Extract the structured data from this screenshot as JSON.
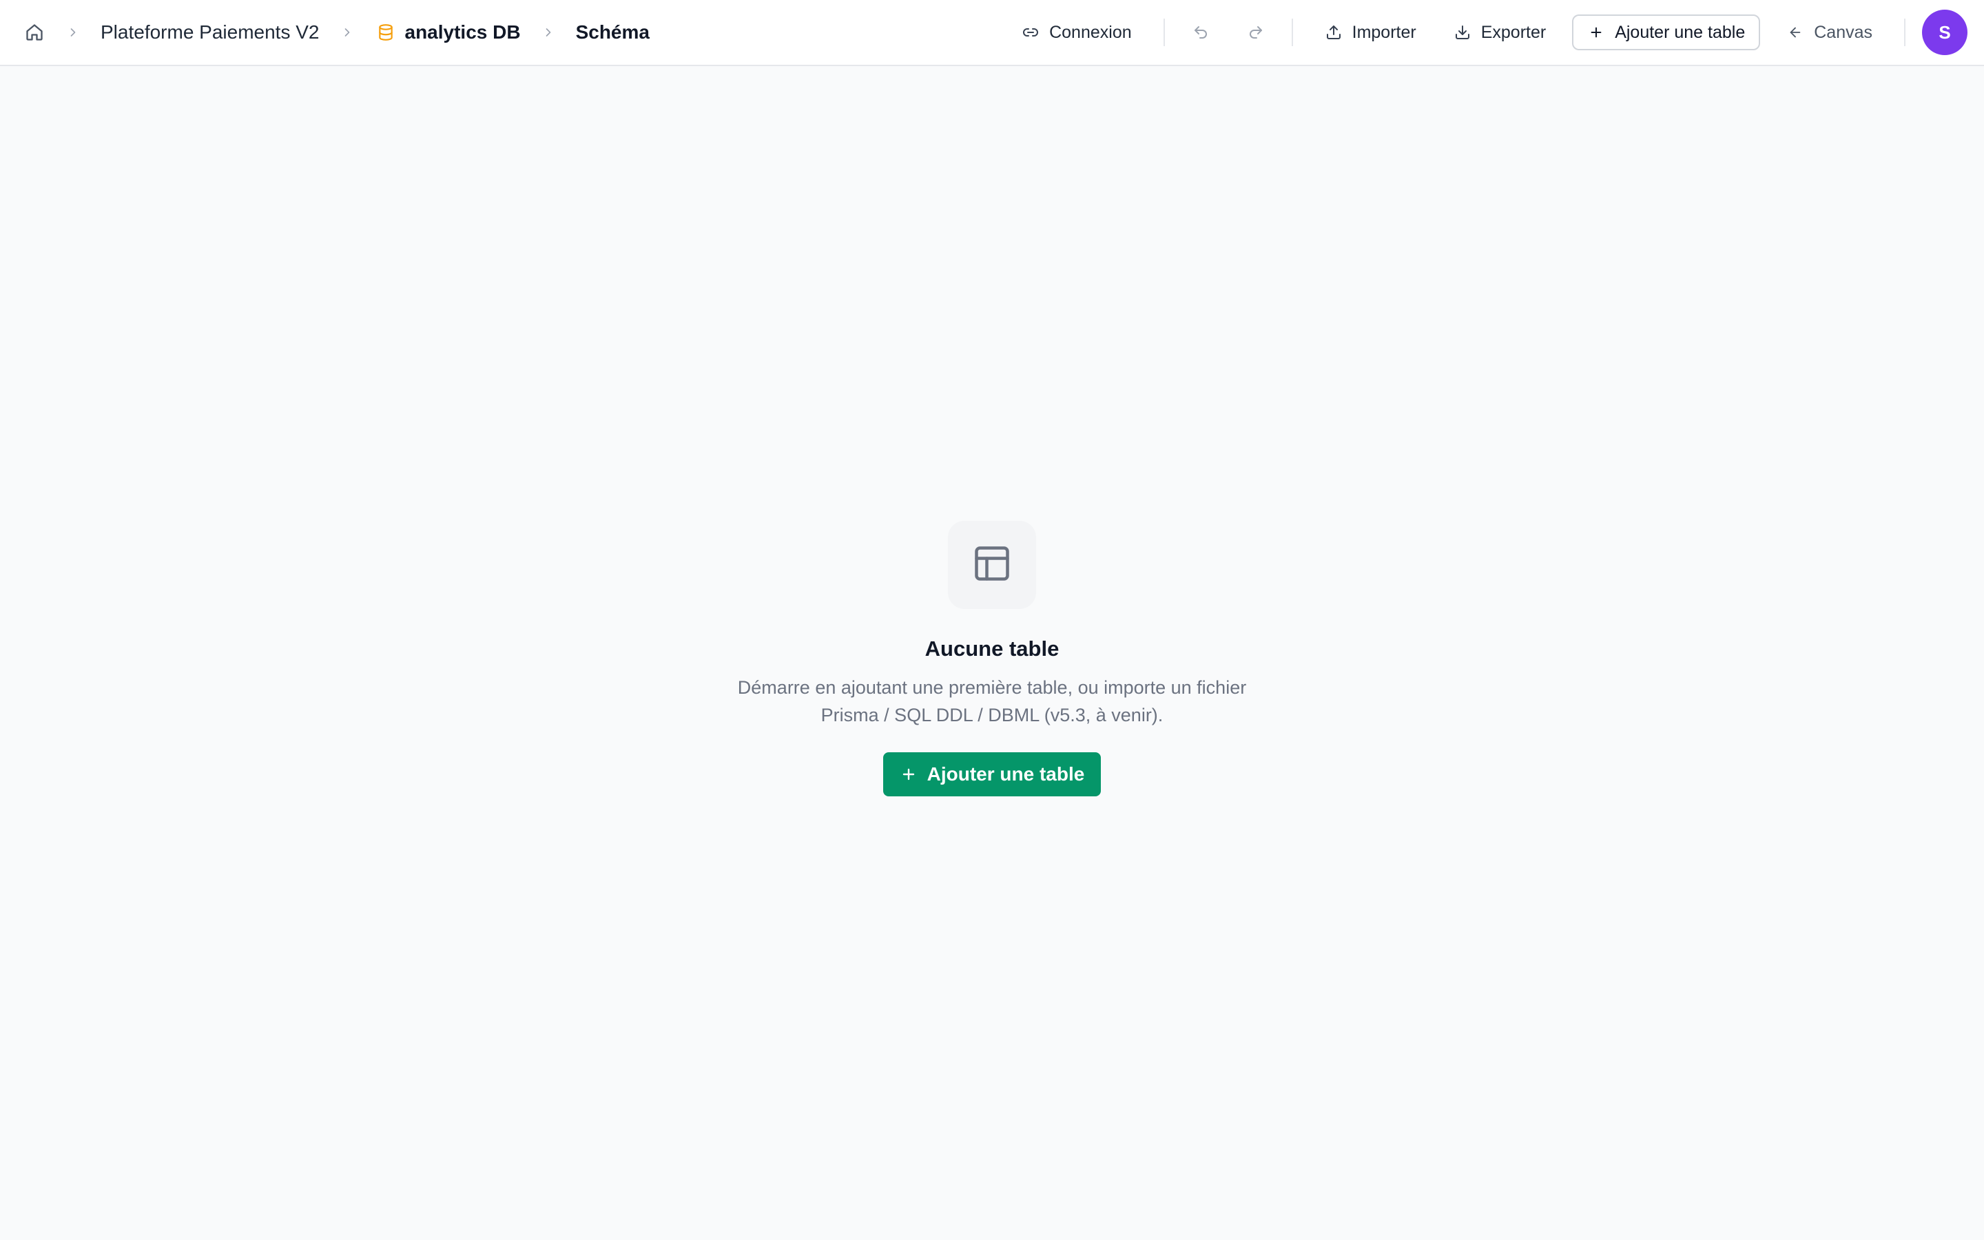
{
  "breadcrumb": {
    "home_icon": "home-icon",
    "project": "Plateforme Paiements V2",
    "database": "analytics DB",
    "database_icon": "database-icon",
    "current": "Schéma"
  },
  "toolbar": {
    "connexion_label": "Connexion",
    "undo_icon": "undo-icon",
    "redo_icon": "redo-icon",
    "import_label": "Importer",
    "export_label": "Exporter",
    "add_table_label": "Ajouter une table",
    "canvas_label": "Canvas",
    "avatar_initial": "S"
  },
  "empty_state": {
    "icon": "table-icon",
    "title": "Aucune table",
    "description": "Démarre en ajoutant une première table, ou importe un fichier Prisma / SQL DDL / DBML (v5.3, à venir).",
    "cta_label": "Ajouter une table"
  },
  "colors": {
    "accent": "#059669",
    "database_icon": "#f59e0b",
    "avatar": "#7c3aed",
    "background": "#f9fafb"
  }
}
